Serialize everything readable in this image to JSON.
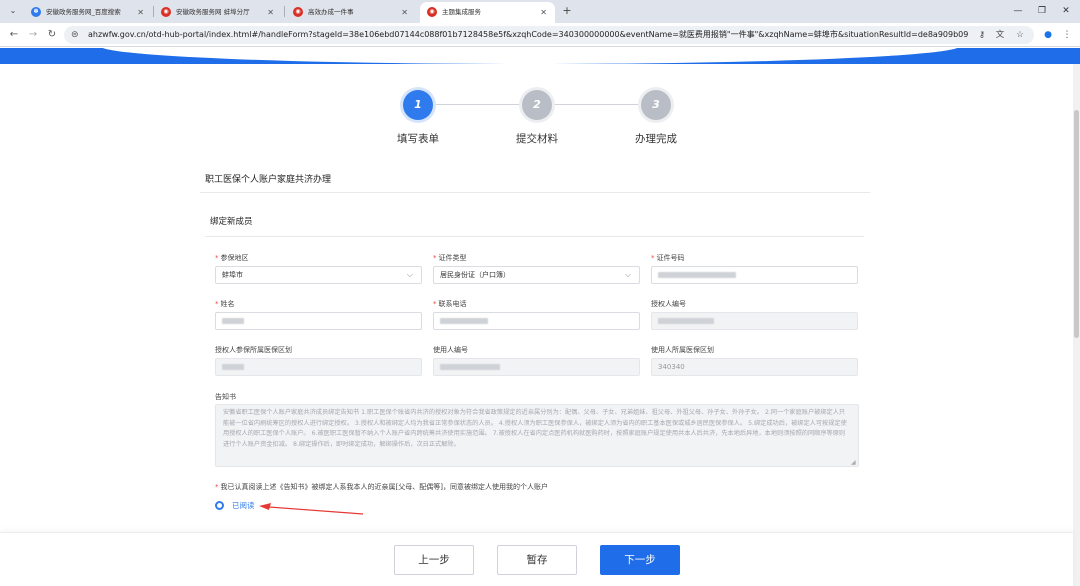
{
  "browser": {
    "tabs": [
      {
        "title": "安徽政务服务网_百度搜索",
        "icon": "paw-icon"
      },
      {
        "title": "安徽政务服务网 蚌埠分厅",
        "icon": "gov-logo-icon"
      },
      {
        "title": "高效办成一件事",
        "icon": "gov-logo-icon"
      },
      {
        "title": "主题集成服务",
        "icon": "gov-logo-icon"
      }
    ],
    "url": "ahzwfw.gov.cn/otd-hub-portal/index.html#/handleForm?stageId=38e106ebd07144c088f01b7128458e5f&xzqhCode=340300000000&eventName=就医费用报销\"一件事\"&xzqhName=蚌埠市&situationResultId=de8a909b098b425c900..."
  },
  "stepper": {
    "steps": [
      {
        "number": "1",
        "label": "填写表单"
      },
      {
        "number": "2",
        "label": "提交材料"
      },
      {
        "number": "3",
        "label": "办理完成"
      }
    ],
    "current": 1
  },
  "form": {
    "page_title": "职工医保个人账户家庭共济办理",
    "section_title": "绑定新成员",
    "fields": {
      "region": {
        "label": "参保地区",
        "value": "蚌埠市"
      },
      "id_type": {
        "label": "证件类型",
        "value": "居民身份证（户口簿）"
      },
      "id_number": {
        "label": "证件号码"
      },
      "name": {
        "label": "姓名"
      },
      "phone": {
        "label": "联系电话"
      },
      "authorizer_no": {
        "label": "授权人编号"
      },
      "authorizer_region": {
        "label": "授权人参保所属医保区划"
      },
      "user_no": {
        "label": "使用人编号"
      },
      "user_region": {
        "label": "使用人所属医保区划",
        "value": "340340"
      }
    },
    "notice_label": "告知书",
    "notice_text": "安徽省职工医保个人账户家庭共济成员绑定告知书 1.职工医保个账省内共济的授权对象为符合我省政策规定的近亲属分别为：配偶、父母、子女、兄弟姐妹、祖父母、外祖父母、孙子女、外孙子女。 2.同一个家庭账户被绑定人只能被一位省内刷统筹区的授权人进行绑定授权。 3.授权人和被绑定人均为我省正常参保状态的人员。 4.授权人须为职工医保参保人，被绑定人须为省内的职工基本医保或城乡居民医保参保人。 5.绑定成功后，被绑定人可按规定使用授权人的职工医保个人账户。 6.被医职工医保暂不纳入个人账户省内跨统筹共济使用实施范围。 7.被授权人在省内定点医药机构就医购药时，按照家庭账户规定使用共本人后共济，先本地后异地，本地则须按照的同顺序等原则进行个人账户资金扣减。 8.绑定操作后，即时绑定成功，解绑操作后，次日正式解除。",
    "agreement_text": "我已认真阅读上述《告知书》被绑定人系我本人的近亲属[父母、配偶等]，同意被绑定人使用我的个人账户",
    "agree_option": "已阅读"
  },
  "actions": {
    "prev": "上一步",
    "save": "暂存",
    "next": "下一步"
  },
  "colors": {
    "primary": "#1f6de8",
    "step_active": "#2f7bed",
    "required": "#e74c3c",
    "annotation_arrow": "#e53935"
  }
}
